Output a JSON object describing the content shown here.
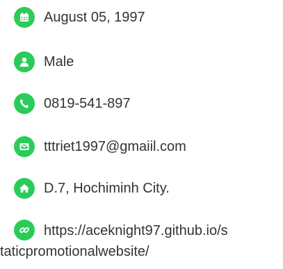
{
  "accent_color": "#2bcb59",
  "items": [
    {
      "icon": "calendar-icon",
      "text": "August 05, 1997"
    },
    {
      "icon": "user-icon",
      "text": "Male"
    },
    {
      "icon": "phone-icon",
      "text": "0819-541-897"
    },
    {
      "icon": "envelope-icon",
      "text": "tttriet1997@gmaiil.com"
    },
    {
      "icon": "home-icon",
      "text": "D.7, Hochiminh City."
    }
  ],
  "website": {
    "icon": "link-icon",
    "text_line1": "https://aceknight97.github.io/s",
    "text_line2": "taticpromotionalwebsite/"
  }
}
